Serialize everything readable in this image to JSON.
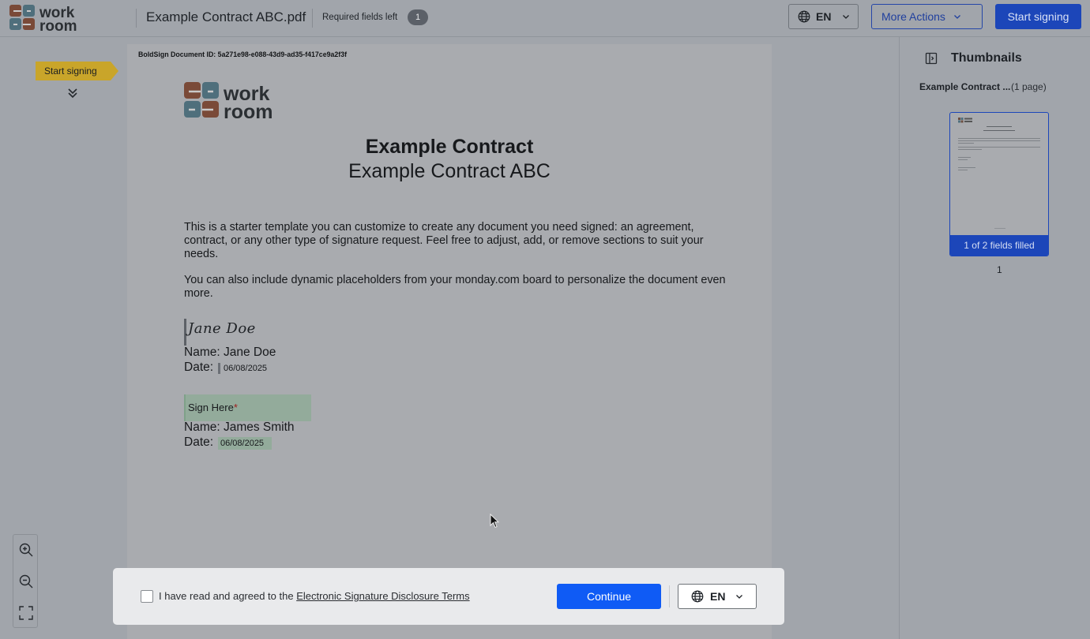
{
  "header": {
    "logo_text": "work room",
    "doc_title": "Example Contract ABC.pdf",
    "required_label": "Required fields left",
    "required_count": "1",
    "language": "EN",
    "more_actions": "More Actions",
    "start_signing": "Start signing"
  },
  "left_rail": {
    "start_flag": "Start signing"
  },
  "document": {
    "doc_id": "BoldSign Document ID: 5a271e98-e088-43d9-ad35-f417ce9a2f3f",
    "logo_text": "work room",
    "title": "Example Contract",
    "subtitle": "Example Contract ABC",
    "paragraph1": "This is a starter template you can customize to create any document you need signed: an agreement, contract, or any other type of signature request. Feel free to adjust, add, or remove sections to suit your needs.",
    "paragraph2": "You can also include dynamic placeholders from your monday.com board to personalize the document even more.",
    "signer1": {
      "signature": "Jane Doe",
      "name_line": "Name: Jane Doe",
      "date_label": "Date:",
      "date_value": "06/08/2025"
    },
    "signer2": {
      "sign_here": "Sign Here",
      "required_mark": "*",
      "name_line": "Name: James Smith",
      "date_label": "Date:",
      "date_value": "06/08/2025"
    }
  },
  "thumbnails": {
    "title": "Thumbnails",
    "doc_name": "Example Contract ...",
    "page_count": "(1 page)",
    "fields_status": "1 of 2 fields filled",
    "page_number": "1"
  },
  "consent": {
    "text_prefix": "I have read and agreed to the",
    "link_text": "Electronic Signature Disclosure Terms",
    "continue": "Continue",
    "language": "EN"
  },
  "colors": {
    "primary": "#0f5bf5",
    "primary_dim": "#1c46b9",
    "overlay_bg": "#a1a5ab",
    "field_green": "#93ab9b",
    "flag_yellow": "#d4a72c"
  },
  "icons": [
    "globe-icon",
    "chevron-down-icon",
    "double-chevron-down-icon",
    "zoom-in-icon",
    "zoom-out-icon",
    "fit-screen-icon",
    "panel-icon",
    "cursor-icon"
  ]
}
